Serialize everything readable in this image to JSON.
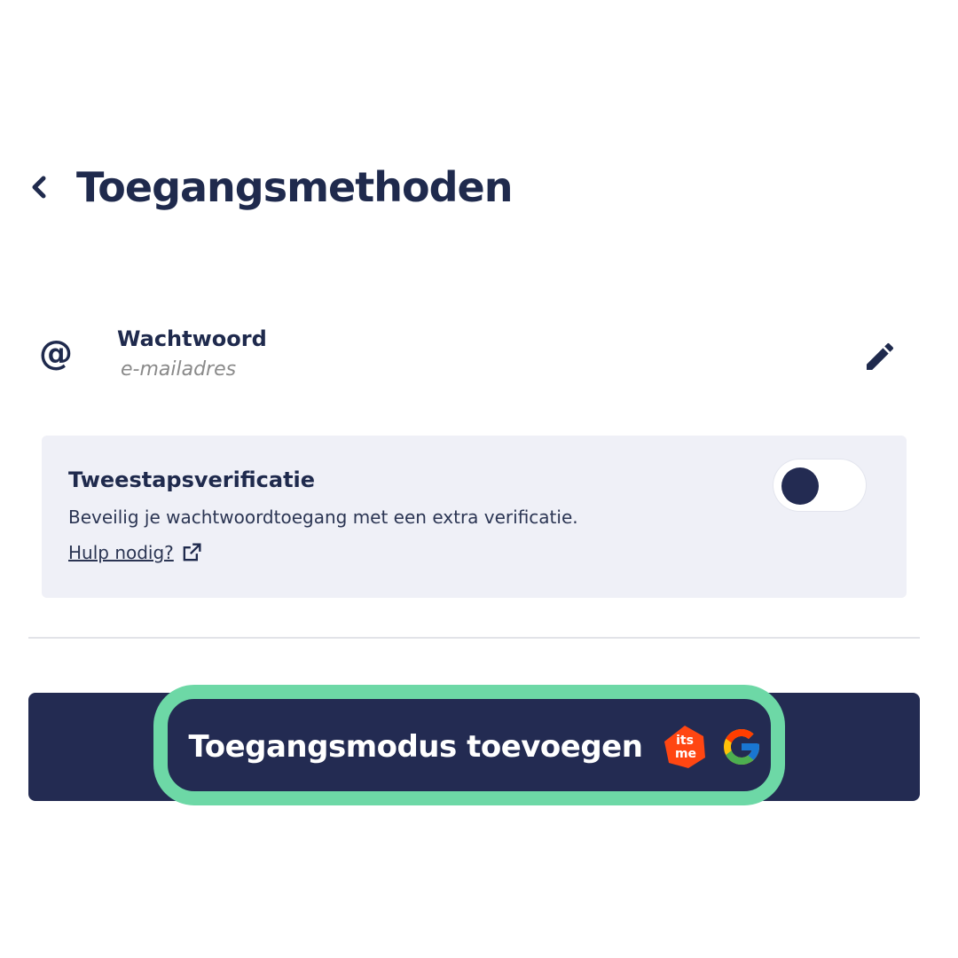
{
  "header": {
    "title": "Toegangsmethoden"
  },
  "password_method": {
    "title": "Wachtwoord",
    "subtitle": "e-mailadres",
    "icon": "at-icon"
  },
  "two_factor": {
    "title": "Tweestapsverificatie",
    "description": "Beveilig je wachtwoordtoegang met een extra verificatie.",
    "help_label": "Hulp nodig?",
    "enabled": false
  },
  "add_button": {
    "label": "Toegangsmodus toevoegen",
    "logo_itsme_text": "its me",
    "logo_google_text": "G"
  },
  "colors": {
    "primary": "#232b52",
    "highlight": "#6dd8a6",
    "panel": "#eff0f7",
    "itsme": "#ff4612"
  }
}
